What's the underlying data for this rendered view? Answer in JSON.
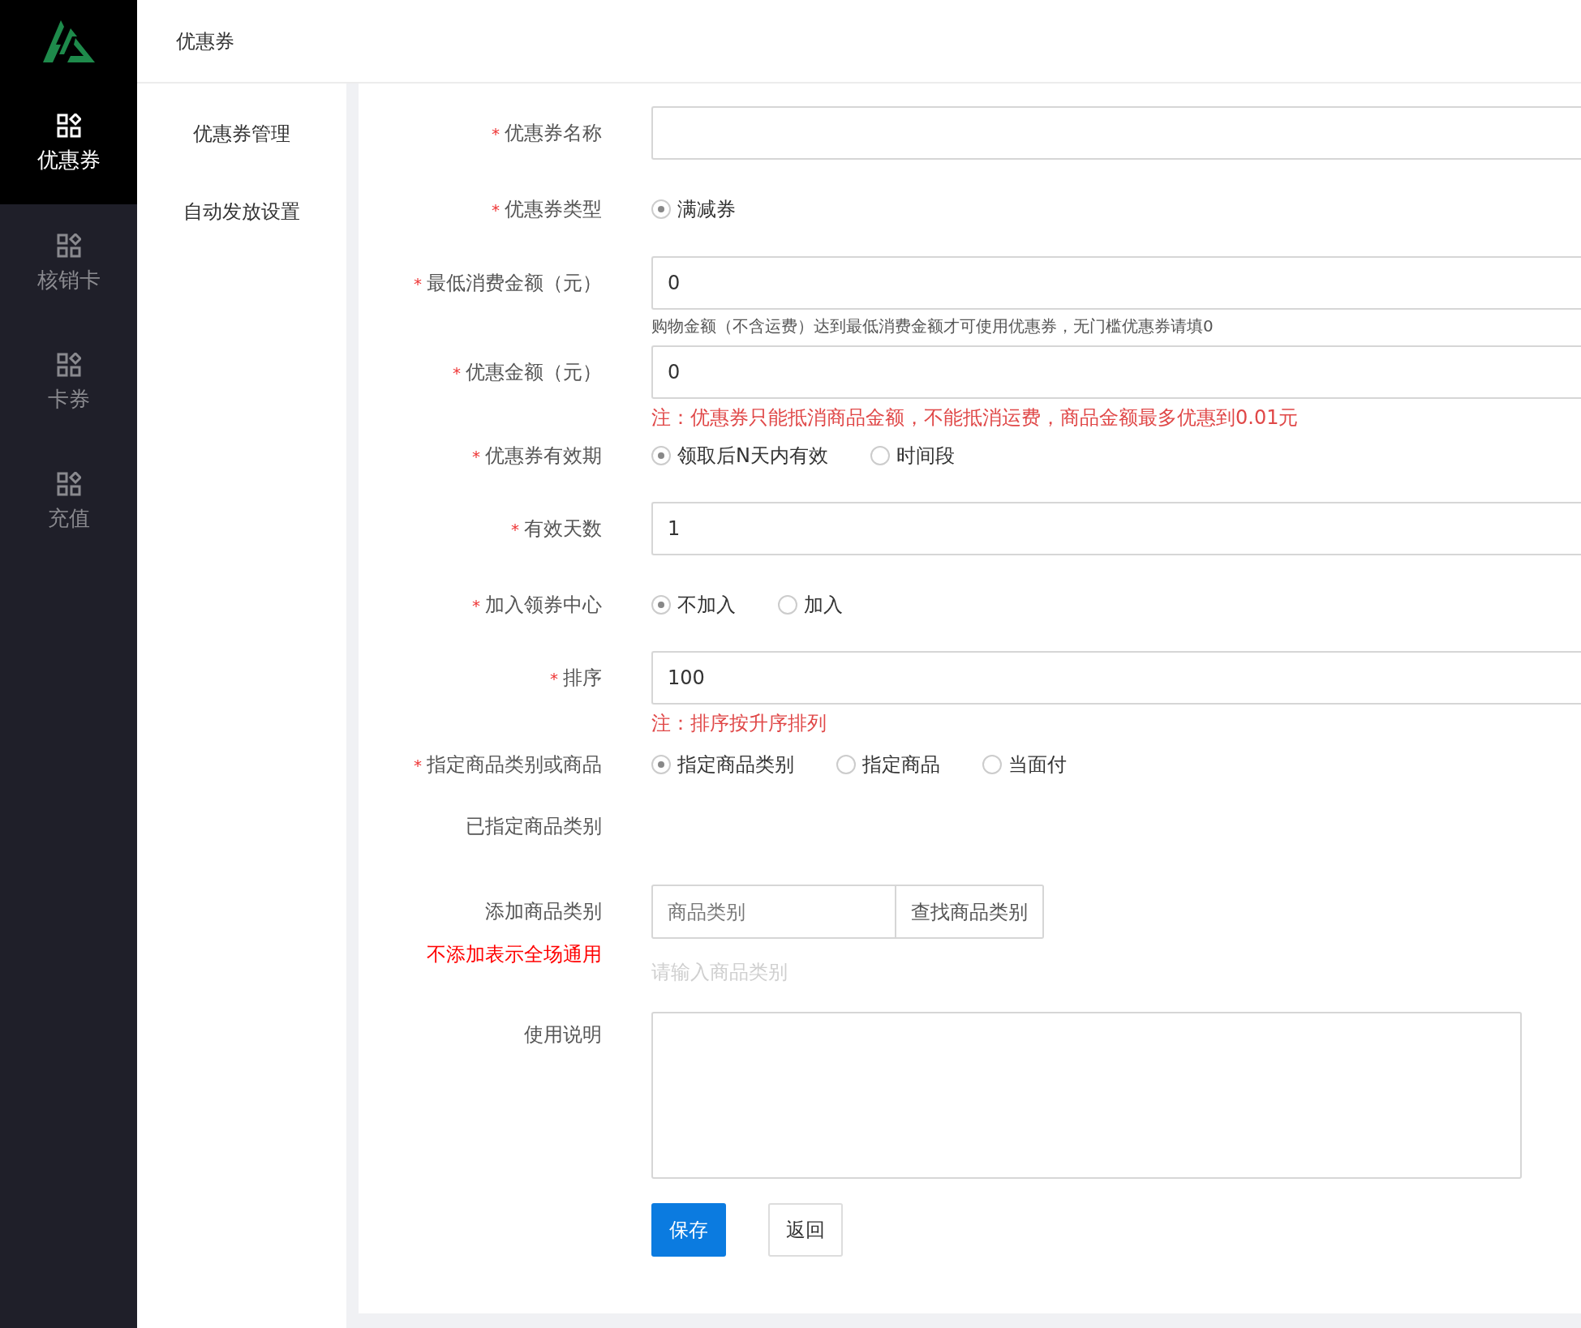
{
  "sidebar": {
    "items": [
      {
        "label": "优惠券",
        "selected": true
      },
      {
        "label": "核销卡",
        "selected": false
      },
      {
        "label": "卡券",
        "selected": false
      },
      {
        "label": "充值",
        "selected": false
      }
    ]
  },
  "header": {
    "title": "优惠券"
  },
  "subnav": {
    "items": [
      {
        "label": "优惠券管理"
      },
      {
        "label": "自动发放设置"
      }
    ]
  },
  "form": {
    "rows": [
      {
        "kind": "input",
        "mark": "*",
        "label": "优惠券名称"
      },
      {
        "kind": "radio",
        "mark": "*",
        "label": "优惠券类型",
        "options": [
          {
            "label": "满减券",
            "selected": true
          }
        ]
      },
      {
        "kind": "input",
        "mark": "*",
        "label": "最低消费金额（元）",
        "value": "0",
        "notes": [
          {
            "kind": "hint",
            "text": "购物金额（不含运费）达到最低消费金额才可使用优惠券，无门槛优惠券请填0"
          }
        ]
      },
      {
        "kind": "input",
        "mark": "*",
        "label": "优惠金额（元）",
        "value": "0",
        "notes": [
          {
            "kind": "warning",
            "text": "注：优惠券只能抵消商品金额，不能抵消运费，商品金额最多优惠到0.01元"
          }
        ]
      },
      {
        "kind": "radio",
        "mark": "*",
        "label": "优惠券有效期",
        "options": [
          {
            "label": "领取后N天内有效",
            "selected": true
          },
          {
            "label": "时间段",
            "selected": false
          }
        ]
      },
      {
        "kind": "input",
        "mark": "*",
        "label": "有效天数",
        "value": "1"
      },
      {
        "kind": "radio",
        "mark": "*",
        "label": "加入领券中心",
        "options": [
          {
            "label": "不加入",
            "selected": true
          },
          {
            "label": "加入",
            "selected": false
          }
        ]
      },
      {
        "kind": "input",
        "mark": "*",
        "label": "排序",
        "value": "100",
        "notes": [
          {
            "kind": "warning",
            "text": "注：排序按升序排列"
          }
        ]
      },
      {
        "kind": "radio",
        "mark": "*",
        "label": "指定商品类别或商品",
        "options": [
          {
            "label": "指定商品类别",
            "selected": true
          },
          {
            "label": "指定商品",
            "selected": false
          },
          {
            "label": "当面付",
            "selected": false
          }
        ]
      },
      {
        "kind": "static",
        "label": "已指定商品类别"
      },
      {
        "kind": "search",
        "label": "添加商品类别",
        "sublabel": "不添加表示全场通用",
        "placeholder": "商品类别",
        "button": "查找商品类别",
        "notes": [
          {
            "kind": "muted",
            "text": "请输入商品类别"
          }
        ]
      },
      {
        "kind": "textarea",
        "label": "使用说明"
      }
    ],
    "buttons": [
      {
        "label": "保存",
        "kind": "primary"
      },
      {
        "label": "返回",
        "kind": "default"
      }
    ]
  }
}
